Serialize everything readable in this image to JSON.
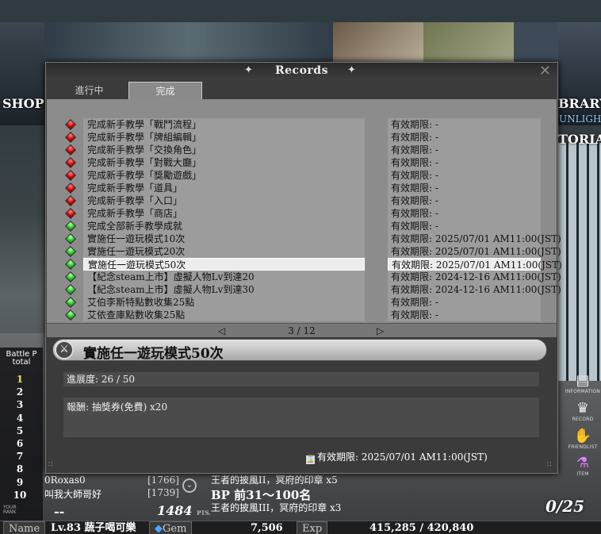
{
  "scene": {
    "shop_label": "SHOP",
    "library_label": "BRARY",
    "unlight_label": "UNLIGHT",
    "tutorial_label": "TORIAL"
  },
  "ranking": {
    "header": "Battle P total",
    "numbers": [
      "1",
      "2",
      "3",
      "4",
      "5",
      "6",
      "7",
      "8",
      "9",
      "10"
    ],
    "entries": [
      {
        "name": "0Roxas0",
        "score": "[1766]"
      },
      {
        "name": "叫我大師哥好",
        "score": "[1739]"
      }
    ],
    "your_rank_label": "YOUR RANK",
    "your_rank_value": "--",
    "points": "1484",
    "points_unit": "PTS."
  },
  "bp": {
    "line1": "王者的披風II，冥府的印章 x5",
    "heading": "BP 前31～100名",
    "line2": "王者的披風III，冥府的印章 x3"
  },
  "right_icons": [
    {
      "icon": "information-icon",
      "label": "INFORMATION"
    },
    {
      "icon": "record-icon",
      "label": "RECORD"
    },
    {
      "icon": "friendlist-icon",
      "label": "FRIENDLIST"
    },
    {
      "icon": "item-icon",
      "label": "ITEM"
    }
  ],
  "crown_counter": "0/25",
  "status_bar": {
    "name_label": "Name",
    "name_value": "Lv.83 蔬子喝可樂",
    "gem_label": "Gem",
    "gem_value": "7,506",
    "exp_label": "Exp",
    "exp_value": "415,285 / 420,840"
  },
  "dialog": {
    "title": "Records",
    "tabs": [
      {
        "label": "進行中",
        "active": false
      },
      {
        "label": "完成",
        "active": true
      }
    ],
    "records": [
      {
        "name": "完成新手教學「戰鬥流程」",
        "expiry": "有效期限: -",
        "gem": "red"
      },
      {
        "name": "完成新手教學「牌組編輯」",
        "expiry": "有效期限: -",
        "gem": "red"
      },
      {
        "name": "完成新手教學「交換角色」",
        "expiry": "有效期限: -",
        "gem": "red"
      },
      {
        "name": "完成新手教學「對戰大廳」",
        "expiry": "有效期限: -",
        "gem": "red"
      },
      {
        "name": "完成新手教學「獎勵遊戲」",
        "expiry": "有效期限: -",
        "gem": "red"
      },
      {
        "name": "完成新手教學「道具」",
        "expiry": "有效期限: -",
        "gem": "red"
      },
      {
        "name": "完成新手教學「入口」",
        "expiry": "有效期限: -",
        "gem": "red"
      },
      {
        "name": "完成新手教學「商店」",
        "expiry": "有效期限: -",
        "gem": "red"
      },
      {
        "name": "完成全部新手教學成就",
        "expiry": "有效期限: -",
        "gem": "green"
      },
      {
        "name": "實施任一遊玩模式10次",
        "expiry": "有效期限: 2025/07/01 AM11:00(JST)",
        "gem": "green"
      },
      {
        "name": "實施任一遊玩模式20次",
        "expiry": "有效期限: 2025/07/01 AM11:00(JST)",
        "gem": "green"
      },
      {
        "name": "實施任一遊玩模式50次",
        "expiry": "有效期限: 2025/07/01 AM11:00(JST)",
        "gem": "green",
        "selected": true
      },
      {
        "name": "【紀念steam上市】虛擬人物Lv到達20",
        "expiry": "有效期限: 2024-12-16 AM11:00(JST)",
        "gem": "green"
      },
      {
        "name": "【紀念steam上市】虛擬人物Lv到達30",
        "expiry": "有效期限: 2024-12-16 AM11:00(JST)",
        "gem": "green"
      },
      {
        "name": "艾伯李斯特點數收集25點",
        "expiry": "有效期限: -",
        "gem": "green"
      },
      {
        "name": "艾依查庫點數收集25點",
        "expiry": "有效期限: -",
        "gem": "green"
      }
    ],
    "pager": "3  /  12",
    "detail": {
      "title": "實施任一遊玩模式50次",
      "progress": "進展度: 26 / 50",
      "reward": "報酬: 抽獎券(免費) x20",
      "expiry": "有效期限: 2025/07/01 AM11:00(JST)"
    }
  }
}
